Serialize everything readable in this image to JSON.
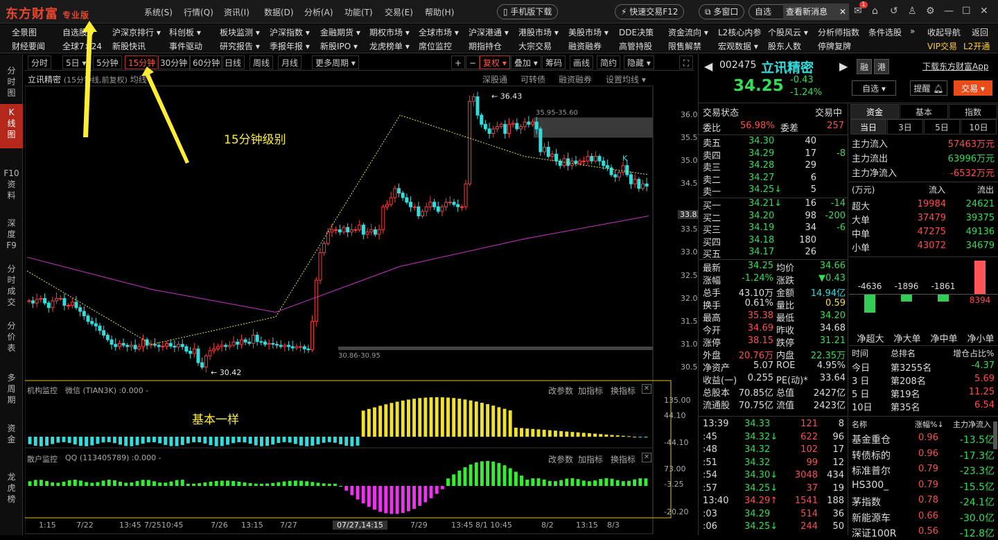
{
  "app": {
    "logo": "东方财富",
    "edition": "专业版"
  },
  "top_menu": [
    "系统(S)",
    "行情(Q)",
    "资讯(I)",
    "数据(D)",
    "分析(A)",
    "功能(T)",
    "交易(E)",
    "帮助(H)"
  ],
  "top_buttons": {
    "mobile": "手机版下载",
    "fast_trade": "快速交易F12",
    "multi_window": "多窗口",
    "partial": "自选",
    "notice": "查看新消息",
    "badge": "1"
  },
  "menu_row1": [
    "全景图",
    "自选股 ▾",
    "沪深京排行 ▾",
    "科创板 ▾",
    "板块监测 ▾",
    "沪深指数 ▾",
    "金融期货 ▾",
    "期权市场 ▾",
    "全球市场 ▾",
    "沪深港通 ▾",
    "港股市场 ▾",
    "美股市场 ▾",
    "DDE决策",
    "资金流向 ▾",
    "L2核心内参",
    "个股风云 ▾",
    "分析师指数",
    "条件选股",
    "»",
    "收起导航",
    "返回"
  ],
  "menu_row2": [
    "财经要闻",
    "全球7×24",
    "新股快讯",
    "事件驱动",
    "研究报告 ▾",
    "季报年报 ▾",
    "新股IPO ▾",
    "龙虎榜单 ▾",
    "席位监控",
    "期指持仓",
    "大宗交易",
    "融资融券",
    "高管持股",
    "限售解禁",
    "宏观数据 ▾",
    "股东人数",
    "停牌复牌",
    "VIP交易",
    "L2开通"
  ],
  "left_nav": [
    {
      "label": "分\n时\n图",
      "active": false
    },
    {
      "label": "K\n线\n图",
      "active": true
    },
    {
      "label": "F10\n资\n料",
      "active": false
    },
    {
      "label": "深\n度\nF9",
      "active": false
    },
    {
      "label": "分\n时\n成\n交",
      "active": false
    },
    {
      "label": "分\n价\n表",
      "active": false
    },
    {
      "label": "多\n周\n期",
      "active": false
    },
    {
      "label": "资\n金",
      "active": false
    },
    {
      "label": "龙\n虎\n榜",
      "active": false
    }
  ],
  "periods": [
    {
      "label": "分时"
    },
    {
      "label": "5日 ▾"
    },
    {
      "label": "5分钟"
    },
    {
      "label": "15分钟",
      "active": true
    },
    {
      "label": "30分钟"
    },
    {
      "label": "60分钟"
    },
    {
      "label": "日线"
    },
    {
      "label": "周线"
    },
    {
      "label": "月线"
    },
    {
      "label": "更多周期 ▾"
    }
  ],
  "chart_tools": [
    "+",
    "−",
    "复权 ▾",
    "叠加 ▾",
    "筹码",
    "画线",
    "简约",
    "隐藏 ▾"
  ],
  "chart": {
    "stock_name": "立讯精密",
    "desc": "(15分钟线,前复权)",
    "ma_label": "均线",
    "links": [
      "深股通",
      "可转债",
      "融资融券",
      "设置均线 ▾"
    ],
    "high_label": "36.43",
    "low_label": "30.42",
    "zone_top": "35.95-35.60",
    "zone_bottom": "30.86-30.95",
    "k_marker": "K",
    "price_axis": [
      "36.00",
      "35.50",
      "35.00",
      "34.50",
      "33.83",
      "33.50",
      "33.00",
      "32.50",
      "32.00",
      "31.50",
      "31.00",
      "30.50"
    ],
    "current_tag": "33.83",
    "annotation_main": "15分钟级别",
    "annotation_sub": "基本一样",
    "ind1": {
      "title": "机构监控",
      "name": "微信 (TIAN3K) :0.000 -",
      "links": [
        "改参数",
        "加指标",
        "换指标"
      ],
      "axis": [
        "135.00",
        "44.10",
        "-44.10"
      ]
    },
    "ind2": {
      "title": "散户监控",
      "name": "QQ (113405789) :0.000 -",
      "links": [
        "改参数",
        "加指标",
        "换指标"
      ],
      "axis": [
        "73.00",
        "-3.25",
        "-20.20"
      ]
    },
    "time_axis": [
      "1:15",
      "7/22",
      "13:45",
      "7/2510:45",
      "7/26",
      "13:15",
      "7/27",
      "07/27,14:15",
      "7/29",
      "13:45",
      "8/1 10:45",
      "8/2",
      "13:15",
      "8/3"
    ]
  },
  "quote": {
    "code": "002475",
    "name": "立讯精密",
    "price": "34.25",
    "change": "-0.43",
    "pct": "-1.24%",
    "btn_rong": "融",
    "btn_gang": "港",
    "download": "下载东方财富App",
    "btn_add": "自选 ▾",
    "btn_alert": "提醒",
    "btn_trade": "交易",
    "status_label": "交易状态",
    "status": "交易中",
    "weibi_label": "委比",
    "weibi": "56.98%",
    "weicha_label": "委差",
    "weicha": "257",
    "sells": [
      {
        "l": "卖五",
        "p": "34.30",
        "v": "40",
        "d": ""
      },
      {
        "l": "卖四",
        "p": "34.29",
        "v": "17",
        "d": "-8"
      },
      {
        "l": "卖三",
        "p": "34.28",
        "v": "29",
        "d": ""
      },
      {
        "l": "卖二",
        "p": "34.27",
        "v": "6",
        "d": ""
      },
      {
        "l": "卖一",
        "p": "34.25↓",
        "v": "5",
        "d": ""
      }
    ],
    "buys": [
      {
        "l": "买一",
        "p": "34.21↓",
        "v": "16",
        "d": "-14"
      },
      {
        "l": "买二",
        "p": "34.20",
        "v": "98",
        "d": "-200"
      },
      {
        "l": "买三",
        "p": "34.19",
        "v": "34",
        "d": "-6"
      },
      {
        "l": "买四",
        "p": "34.18",
        "v": "180",
        "d": ""
      },
      {
        "l": "买五",
        "p": "34.17",
        "v": "26",
        "d": ""
      }
    ],
    "stats": [
      [
        "最新",
        "34.25",
        "均价",
        "34.66"
      ],
      [
        "涨幅",
        "-1.24%",
        "涨跌",
        "▼0.43"
      ],
      [
        "总手",
        "43.10万",
        "金额",
        "14.94亿"
      ],
      [
        "换手",
        "0.61%",
        "量比",
        "0.59"
      ],
      [
        "最高",
        "35.38",
        "最低",
        "34.20"
      ],
      [
        "今开",
        "34.69",
        "昨收",
        "34.68"
      ],
      [
        "涨停",
        "38.15",
        "跌停",
        "31.21"
      ],
      [
        "外盘",
        "20.76万",
        "内盘",
        "22.35万"
      ],
      [
        "净资产",
        "5.07",
        "ROE",
        "4.95%"
      ],
      [
        "收益(一)",
        "0.255",
        "PE(动)*",
        "33.64"
      ],
      [
        "总股本",
        "70.85亿",
        "总值",
        "2427亿"
      ],
      [
        "流通股",
        "70.75亿",
        "流值",
        "2423亿"
      ]
    ],
    "ticks": [
      [
        "13:39",
        "34.33",
        "121",
        "8"
      ],
      [
        ":45",
        "34.32↓",
        "622",
        "96"
      ],
      [
        ":48",
        "34.32",
        "102",
        "17"
      ],
      [
        ":51",
        "34.32",
        "99",
        "12"
      ],
      [
        ":54",
        "34.30↓",
        "3048",
        "434"
      ],
      [
        ":57",
        "34.25↓",
        "37",
        "19"
      ],
      [
        "13:40",
        "34.29↑",
        "1541",
        "188"
      ],
      [
        ":03",
        "34.29",
        "514",
        "36"
      ],
      [
        ":06",
        "34.25↓",
        "244",
        "50"
      ]
    ]
  },
  "fund": {
    "tabs": [
      "资金",
      "基本",
      "指数"
    ],
    "days": [
      "当日",
      "3日",
      "5日",
      "10日"
    ],
    "main_in": [
      "主力流入",
      "57463万元"
    ],
    "main_out": [
      "主力流出",
      "63996万元"
    ],
    "main_net": [
      "主力净流入",
      "-6532万元"
    ],
    "unit": "(万元)",
    "in_label": "流入",
    "out_label": "流出",
    "rows": [
      [
        "超大",
        "19984",
        "24621"
      ],
      [
        "大单",
        "37479",
        "39375"
      ],
      [
        "中单",
        "47275",
        "49136"
      ],
      [
        "小单",
        "43072",
        "34679"
      ]
    ],
    "bars": [
      {
        "label": "净超大",
        "value": -4636
      },
      {
        "label": "净大单",
        "value": -1896
      },
      {
        "label": "净中单",
        "value": -1861
      },
      {
        "label": "净小单",
        "value": 8394
      }
    ],
    "rank_head": [
      "时间",
      "总排名",
      "增仓占比%"
    ],
    "ranks": [
      [
        "今日",
        "第3255名",
        "-4.37"
      ],
      [
        "3 日",
        "第208名",
        "5.69"
      ],
      [
        "5 日",
        "第19名",
        "11.25"
      ],
      [
        "10日",
        "第35名",
        "6.54"
      ]
    ],
    "sector_head": [
      "名称",
      "涨幅%↓",
      "主力净流入"
    ],
    "sectors": [
      [
        "基金重仓",
        "0.96",
        "-13.5亿"
      ],
      [
        "转债标的",
        "0.96",
        "-17.3亿"
      ],
      [
        "标准普尔",
        "0.79",
        "-23.3亿"
      ],
      [
        "HS300_",
        "0.79",
        "-15.5亿"
      ],
      [
        "茅指数",
        "0.78",
        "-24.1亿"
      ],
      [
        "新能源车",
        "0.66",
        "-30.0亿"
      ],
      [
        "深证100R",
        "0.56",
        "-12.8亿"
      ]
    ]
  },
  "chart_data": {
    "type": "candlestick",
    "title": "立讯精密 (15分钟线,前复权)",
    "ylim": [
      30.3,
      36.5
    ],
    "annotated_high": 36.43,
    "annotated_low": 30.42,
    "close": [
      31.95,
      31.9,
      31.98,
      32.0,
      31.9,
      31.8,
      31.95,
      32.0,
      32.0,
      31.85,
      31.85,
      31.92,
      31.8,
      31.72,
      31.62,
      31.5,
      31.45,
      31.4,
      31.3,
      31.2,
      31.1,
      31.0,
      30.95,
      31.02,
      30.98,
      30.95,
      30.98,
      30.9,
      30.95,
      31.1,
      30.98,
      31.0,
      30.98,
      30.95,
      30.96,
      31.02,
      30.96,
      30.94,
      31.0,
      30.95,
      30.85,
      30.8,
      30.9,
      30.6,
      30.5,
      30.75,
      30.86,
      30.9,
      30.95,
      30.98,
      30.95,
      30.98,
      31.05,
      31.0,
      31.1,
      31.05,
      31.02,
      31.2,
      31.06,
      31.05,
      31.0,
      31.02,
      31.0,
      30.98,
      30.95,
      30.98,
      30.95,
      30.92,
      30.95,
      30.95,
      30.9,
      30.88,
      31.5,
      32.4,
      33.0,
      33.2,
      33.45,
      33.5,
      33.5,
      33.45,
      33.55,
      33.45,
      33.5,
      33.5,
      33.6,
      33.4,
      33.45,
      33.5,
      33.4,
      33.5,
      34.0,
      34.05,
      34.2,
      34.4,
      34.3,
      34.2,
      34.1,
      34.0,
      34.0,
      33.8,
      33.9,
      34.0,
      34.1,
      34.0,
      33.9,
      34.0,
      34.1,
      34.1,
      34.05,
      34.0,
      34.0,
      34.5,
      36.3,
      36.4,
      36.0,
      35.8,
      35.7,
      35.6,
      35.7,
      35.75,
      35.8,
      35.6,
      35.8,
      35.82,
      35.7,
      35.75,
      35.85,
      35.8,
      35.85,
      35.7,
      35.2,
      35.3,
      35.1,
      35.15,
      35.0,
      34.9,
      35.05,
      34.9,
      35.0,
      34.95,
      35.0,
      35.0,
      35.1,
      35.0,
      35.1,
      35.0,
      34.9,
      34.85,
      34.7,
      34.65,
      34.75,
      34.9,
      34.7,
      34.5,
      34.6,
      34.4,
      34.5,
      34.45
    ],
    "ma_short": [
      32.6,
      31.0,
      31.6,
      36.0,
      35.1,
      34.7
    ],
    "ma_long": [
      32.9,
      32.2,
      31.7,
      32.7,
      33.3,
      33.8
    ],
    "indicator1": {
      "name": "机构监控",
      "min": -44.1,
      "max": 135.0
    },
    "indicator2": {
      "name": "散户监控",
      "min": -20.2,
      "max": 73.0
    }
  }
}
